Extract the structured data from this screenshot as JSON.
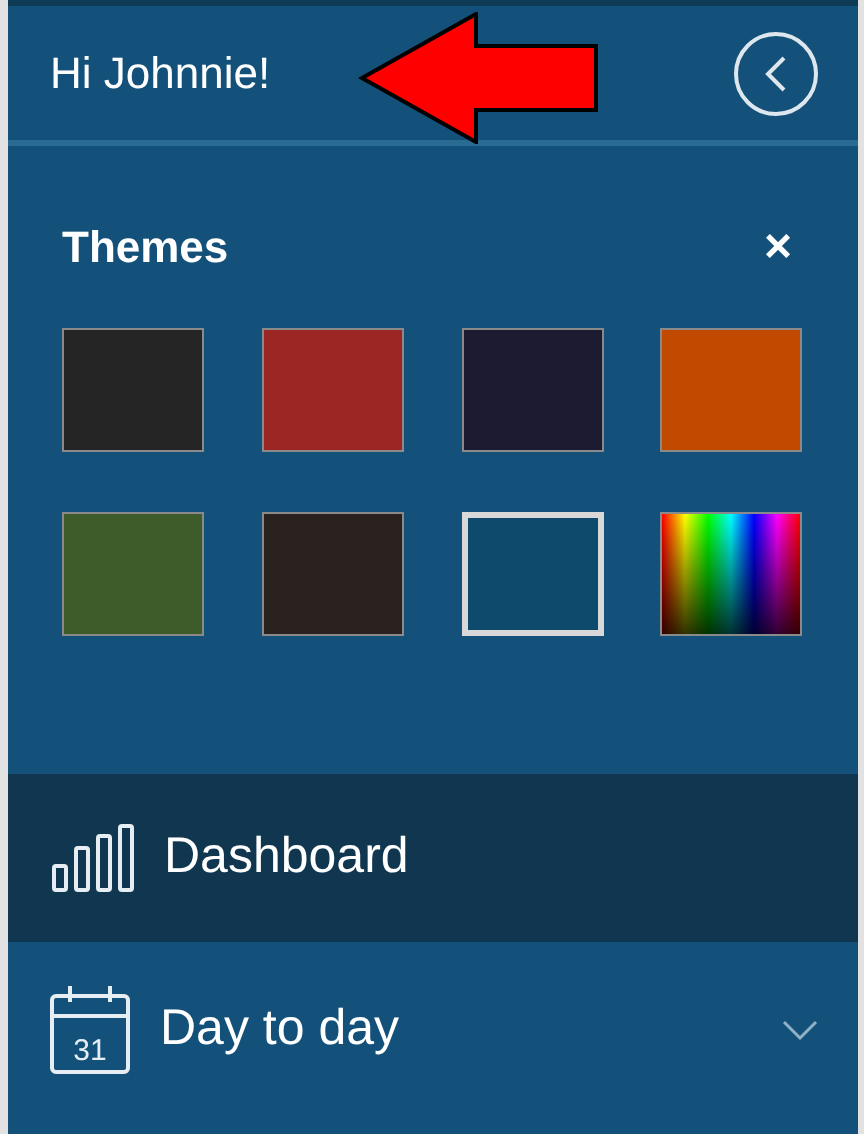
{
  "header": {
    "greeting": "Hi Johnnie!"
  },
  "themes": {
    "title": "Themes",
    "close_label": "×",
    "swatches": [
      {
        "kind": "solid",
        "color": "#252525",
        "selected": false
      },
      {
        "kind": "solid",
        "color": "#9b2624",
        "selected": false
      },
      {
        "kind": "solid",
        "color": "#1d1b31",
        "selected": false
      },
      {
        "kind": "solid",
        "color": "#c24a00",
        "selected": false
      },
      {
        "kind": "solid",
        "color": "#3d5c2a",
        "selected": false
      },
      {
        "kind": "solid",
        "color": "#2a221e",
        "selected": false
      },
      {
        "kind": "solid",
        "color": "#0d4a6b",
        "selected": true
      },
      {
        "kind": "spectrum",
        "selected": false
      }
    ]
  },
  "menu": [
    {
      "kind": "chart",
      "label": "Dashboard",
      "selected": true
    },
    {
      "kind": "calendar",
      "label": "Day to day",
      "calendar_day": "31",
      "selected": false,
      "expanded": false
    }
  ]
}
